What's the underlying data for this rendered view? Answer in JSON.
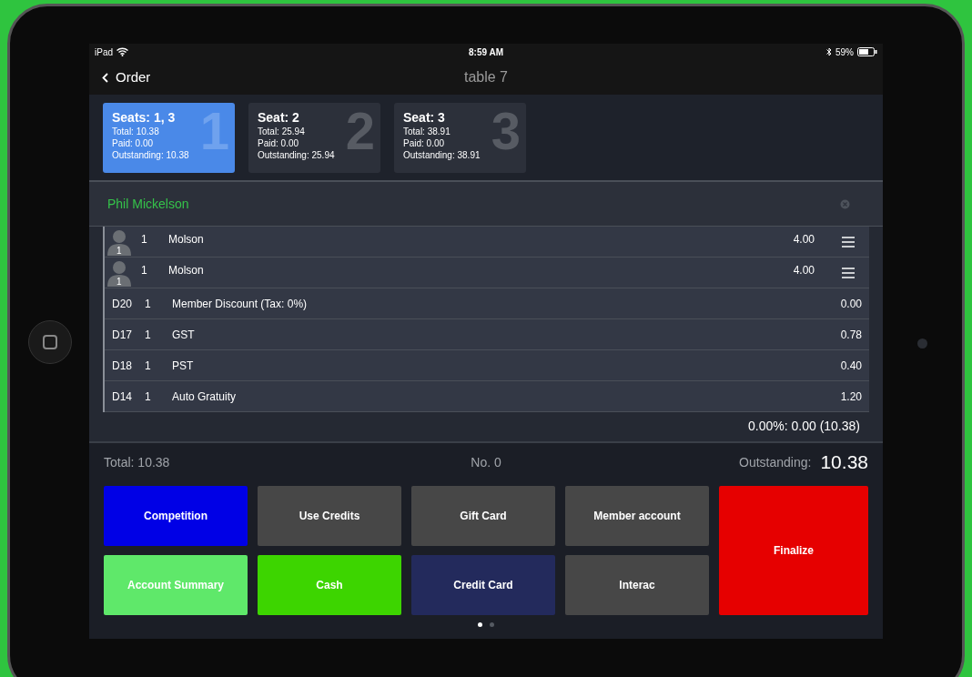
{
  "status_bar": {
    "carrier": "iPad",
    "time": "8:59 AM",
    "battery": "59%"
  },
  "nav": {
    "back": "Order",
    "title": "table 7"
  },
  "seats": [
    {
      "title": "Seats: 1, 3",
      "total": "Total: 10.38",
      "paid": "Paid: 0.00",
      "outstanding": "Outstanding: 10.38",
      "number": "1",
      "selected": true
    },
    {
      "title": "Seat: 2",
      "total": "Total: 25.94",
      "paid": "Paid: 0.00",
      "outstanding": "Outstanding: 25.94",
      "number": "2",
      "selected": false
    },
    {
      "title": "Seat: 3",
      "total": "Total: 38.91",
      "paid": "Paid: 0.00",
      "outstanding": "Outstanding: 38.91",
      "number": "3",
      "selected": false
    }
  ],
  "customer": {
    "name": "Phil Mickelson"
  },
  "lines": [
    {
      "kind": "item",
      "seat": "1",
      "qty": "1",
      "name": "Molson",
      "amount": "4.00"
    },
    {
      "kind": "item",
      "seat": "1",
      "qty": "1",
      "name": "Molson",
      "amount": "4.00"
    },
    {
      "kind": "charge",
      "code": "D20",
      "qty": "1",
      "name": "Member Discount (Tax: 0%)",
      "amount": "0.00"
    },
    {
      "kind": "charge",
      "code": "D17",
      "qty": "1",
      "name": "GST",
      "amount": "0.78"
    },
    {
      "kind": "charge",
      "code": "D18",
      "qty": "1",
      "name": "PST",
      "amount": "0.40"
    },
    {
      "kind": "charge",
      "code": "D14",
      "qty": "1",
      "name": "Auto Gratuity",
      "amount": "1.20"
    }
  ],
  "summary": "0.00%: 0.00 (10.38)",
  "totals": {
    "total": "Total: 10.38",
    "number": "No. 0",
    "outstanding_label": "Outstanding:",
    "outstanding": "10.38"
  },
  "buttons": [
    {
      "label": "Competition",
      "color": "#0000e6"
    },
    {
      "label": "Use Credits",
      "color": "#474747"
    },
    {
      "label": "Gift Card",
      "color": "#474747"
    },
    {
      "label": "Member account",
      "color": "#474747"
    },
    {
      "label": "Account Summary",
      "color": "#5fe86a"
    },
    {
      "label": "Cash",
      "color": "#3dd500"
    },
    {
      "label": "Credit Card",
      "color": "#232a5c"
    },
    {
      "label": "Interac",
      "color": "#474747"
    }
  ],
  "finalize": {
    "label": "Finalize",
    "color": "#e60000"
  },
  "pages": [
    {
      "selected": true
    },
    {
      "selected": false
    }
  ]
}
